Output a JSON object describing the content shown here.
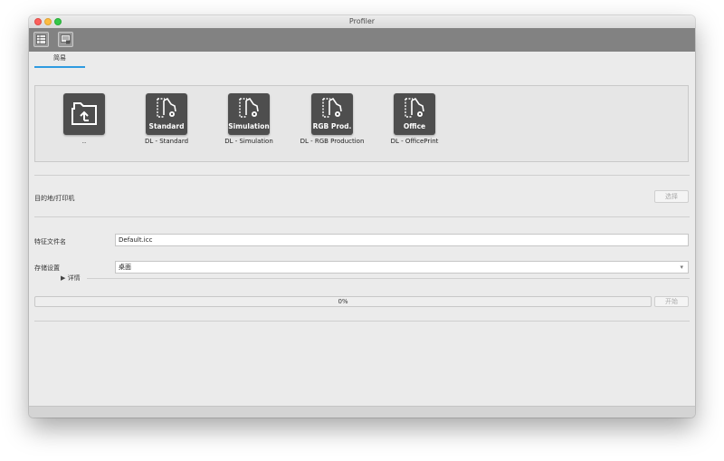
{
  "window": {
    "title": "Profiler"
  },
  "toolbar": {
    "buttons": [
      {
        "icon": "profile-table-icon"
      },
      {
        "icon": "profile-export-icon"
      }
    ]
  },
  "tabs": [
    {
      "label": "简易",
      "active": true
    }
  ],
  "profiles": [
    {
      "icon": "folder-up-icon",
      "tag": "",
      "label": ".."
    },
    {
      "icon": "color-profile-icon",
      "tag": "Standard",
      "label": "DL - Standard"
    },
    {
      "icon": "color-profile-icon",
      "tag": "Simulation",
      "label": "DL - Simulation"
    },
    {
      "icon": "color-profile-icon",
      "tag": "RGB Prod.",
      "label": "DL - RGB Production"
    },
    {
      "icon": "color-profile-icon",
      "tag": "Office",
      "label": "DL - OfficePrint"
    }
  ],
  "destination": {
    "label": "目的地/打印机",
    "button": "选择"
  },
  "profile_name": {
    "label": "特征文件名",
    "value": "Default.icc"
  },
  "save_settings": {
    "label": "存储设置",
    "value": "桌面",
    "details": "▶ 详情"
  },
  "progress": {
    "value": 0,
    "text": "0%",
    "button": "开始"
  },
  "colors": {
    "accent": "#2e9be0",
    "toolbar": "#828282",
    "tile": "#4e4e4e"
  }
}
